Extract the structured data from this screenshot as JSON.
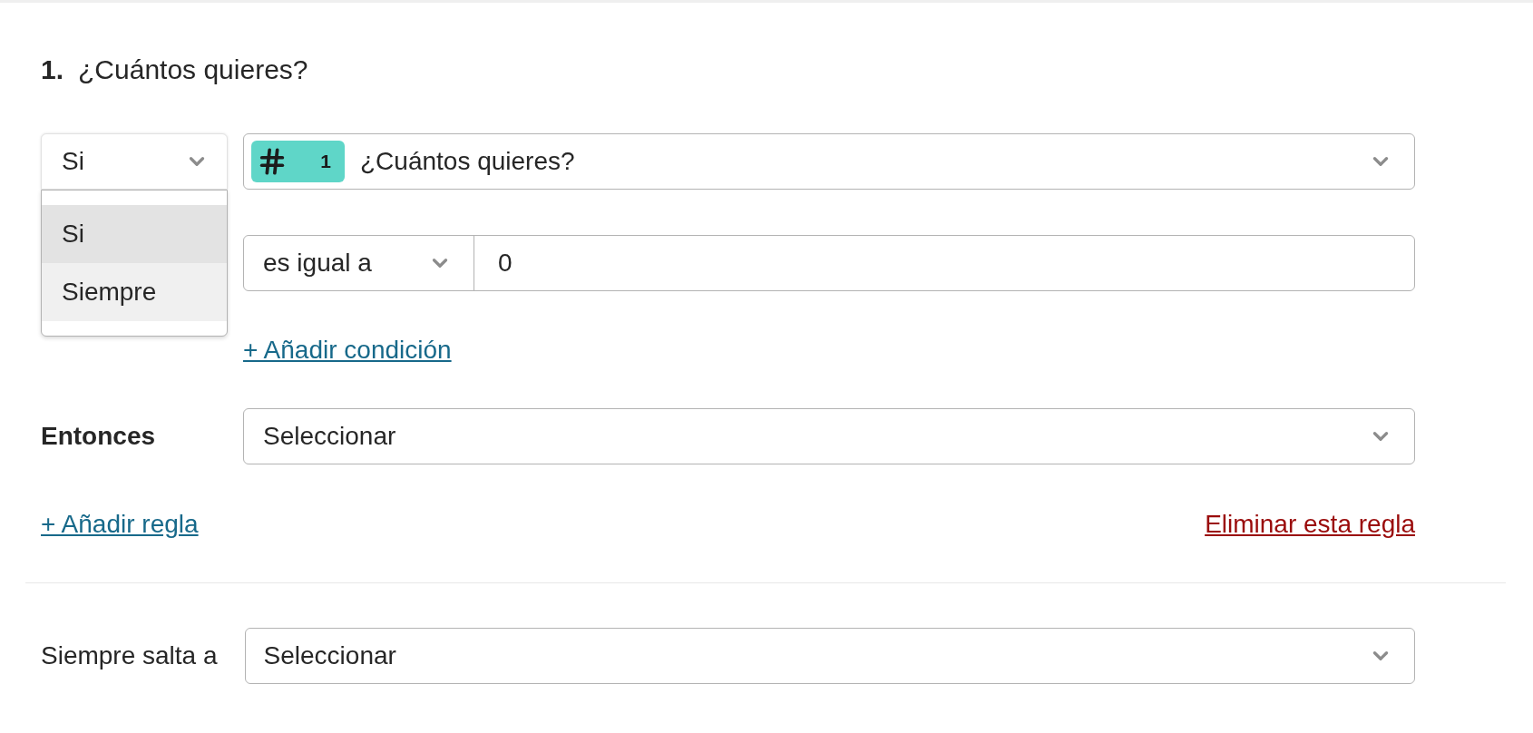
{
  "question": {
    "number": "1.",
    "title": "¿Cuántos quieres?"
  },
  "rule": {
    "condition_select": {
      "value": "Si",
      "expanded": true,
      "options": [
        {
          "label": "Si",
          "selected": true
        },
        {
          "label": "Siempre",
          "selected": false
        }
      ]
    },
    "question_select": {
      "badge_number": "1",
      "value": "¿Cuántos quieres?"
    },
    "operator_select": {
      "value": "es igual a"
    },
    "value_field": {
      "value": "0"
    },
    "add_condition_link": "+ Añadir condición",
    "then_label": "Entonces",
    "then_select": {
      "value": "Seleccionar"
    },
    "add_rule_link": "+ Añadir regla",
    "delete_rule_link": "Eliminar esta regla"
  },
  "always_jump": {
    "label": "Siempre salta a",
    "select": {
      "value": "Seleccionar"
    }
  }
}
